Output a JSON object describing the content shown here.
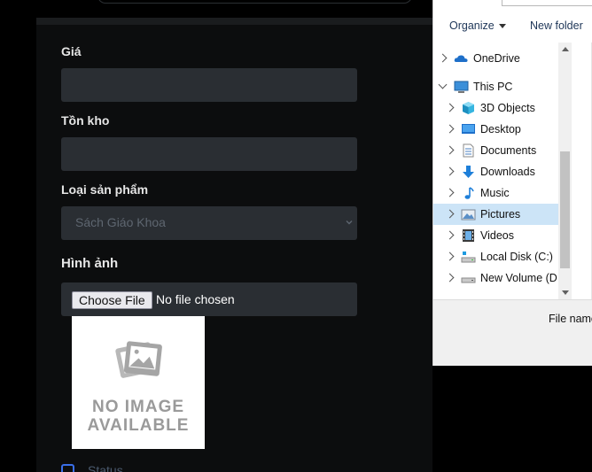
{
  "form": {
    "price_label": "Giá",
    "stock_label": "Tồn kho",
    "category_label": "Loại sản phẩm",
    "category_selected": "Sách Giáo Khoa",
    "image_label": "Hình ảnh",
    "choose_file_button": "Choose File",
    "file_status": "No file chosen",
    "no_image_line1": "NO IMAGE",
    "no_image_line2": "AVAILABLE",
    "status_label": "Status"
  },
  "dialog": {
    "organize_label": "Organize",
    "new_folder_label": "New folder",
    "file_name_label": "File name",
    "tree": [
      {
        "label": "OneDrive",
        "icon": "cloud-icon",
        "level": 0,
        "expanded": false
      },
      {
        "label": "This PC",
        "icon": "computer-icon",
        "level": 0,
        "expanded": true
      },
      {
        "label": "3D Objects",
        "icon": "cube-icon",
        "level": 1,
        "expanded": false
      },
      {
        "label": "Desktop",
        "icon": "desktop-icon",
        "level": 1,
        "expanded": false
      },
      {
        "label": "Documents",
        "icon": "document-icon",
        "level": 1,
        "expanded": false
      },
      {
        "label": "Downloads",
        "icon": "download-icon",
        "level": 1,
        "expanded": false
      },
      {
        "label": "Music",
        "icon": "music-icon",
        "level": 1,
        "expanded": false
      },
      {
        "label": "Pictures",
        "icon": "pictures-icon",
        "level": 1,
        "expanded": false,
        "selected": true
      },
      {
        "label": "Videos",
        "icon": "video-icon",
        "level": 1,
        "expanded": false
      },
      {
        "label": "Local Disk (C:)",
        "icon": "drive-icon",
        "level": 1,
        "expanded": false
      },
      {
        "label": "New Volume (D:",
        "icon": "drive-icon",
        "level": 1,
        "expanded": false
      }
    ]
  },
  "colors": {
    "page_bg": "#000000",
    "input_bg": "#2a2e33",
    "selection": "#cce4f7",
    "accent": "#3a6ee8"
  }
}
